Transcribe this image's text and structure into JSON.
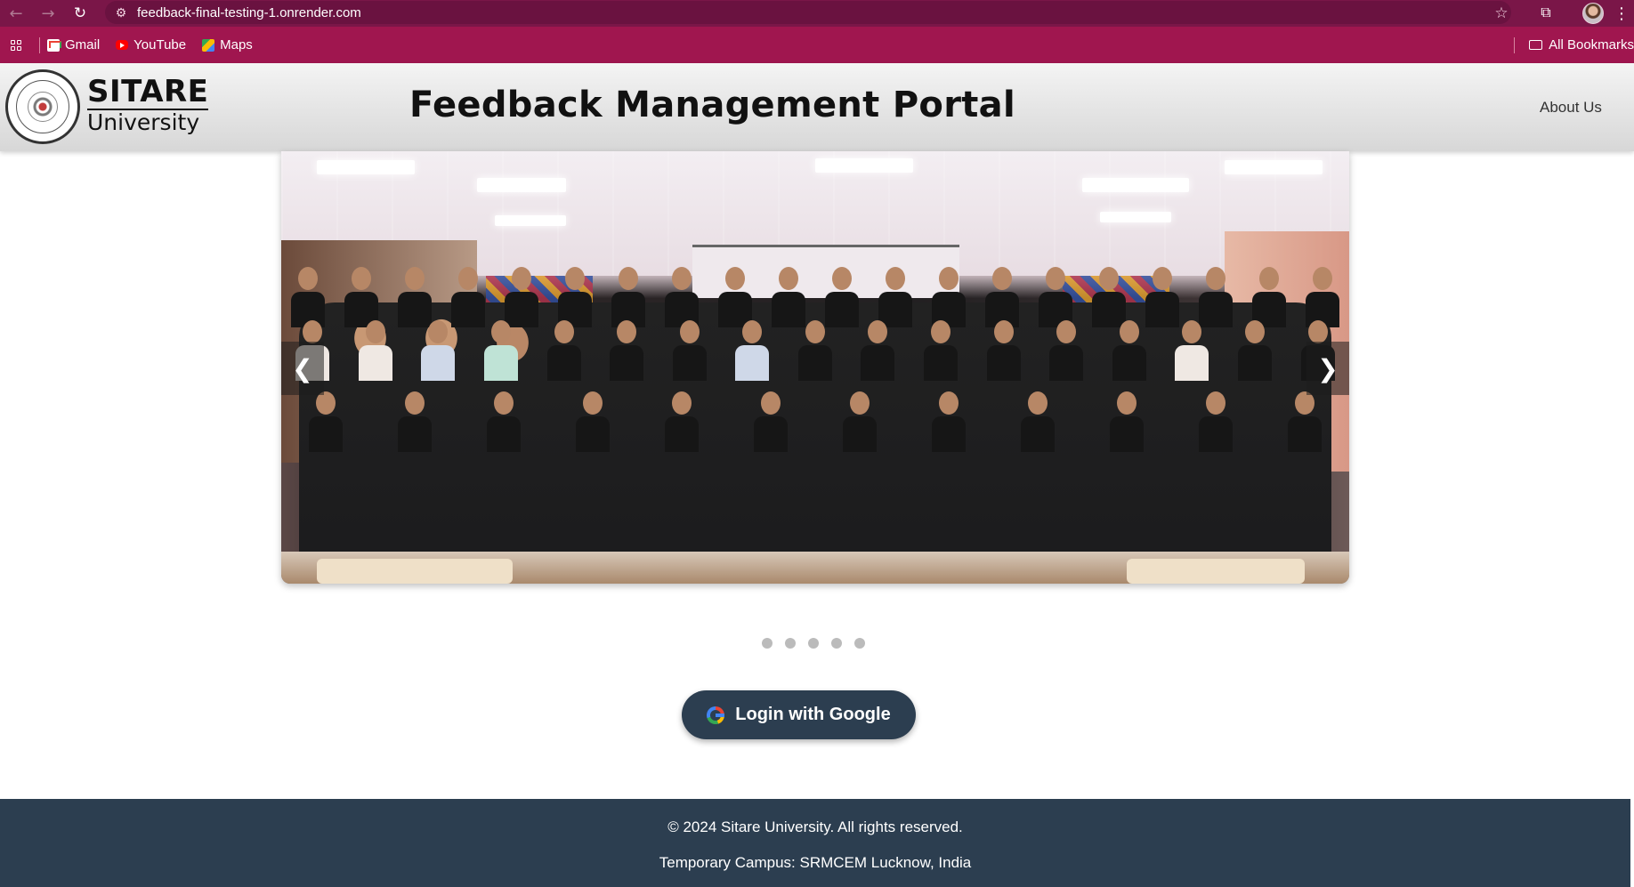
{
  "browser": {
    "url": "feedback-final-testing-1.onrender.com",
    "bookmarks": [
      {
        "label": "Gmail",
        "icon": "gmail-icon"
      },
      {
        "label": "YouTube",
        "icon": "youtube-icon"
      },
      {
        "label": "Maps",
        "icon": "maps-icon"
      }
    ],
    "all_bookmarks_label": "All Bookmarks"
  },
  "header": {
    "logo_line1": "SITARE",
    "logo_line2": "University",
    "title": "Feedback Management Portal",
    "about_label": "About Us"
  },
  "carousel": {
    "prev_glyph": "❮",
    "next_glyph": "❯",
    "slide_count": 5,
    "active_index": 0
  },
  "login": {
    "label": "Login with Google"
  },
  "footer": {
    "copyright": "© 2024 Sitare University. All rights reserved.",
    "campus": "Temporary Campus: SRMCEM Lucknow, India"
  },
  "colors": {
    "browser_bar": "#7a1648",
    "bookmark_bar": "#a0164f",
    "primary_dark": "#2c3e50"
  }
}
